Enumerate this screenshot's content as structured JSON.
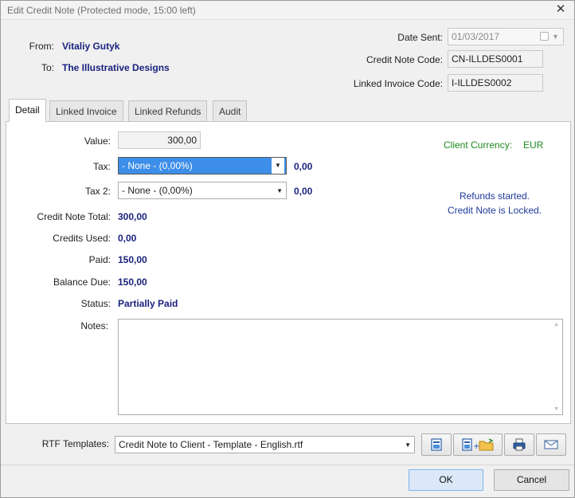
{
  "window": {
    "title": "Edit Credit Note (Protected mode, 15:00 left)"
  },
  "header": {
    "from_label": "From:",
    "from_value": "Vitaliy Gutyk",
    "to_label": "To:",
    "to_value": "The Illustrative Designs",
    "date_sent_label": "Date Sent:",
    "date_sent_value": "01/03/2017",
    "credit_note_code_label": "Credit Note Code:",
    "credit_note_code_value": "CN-ILLDES0001",
    "linked_invoice_code_label": "Linked Invoice Code:",
    "linked_invoice_code_value": "I-ILLDES0002"
  },
  "tabs": [
    {
      "label": "Detail",
      "active": true
    },
    {
      "label": "Linked Invoice",
      "active": false
    },
    {
      "label": "Linked Refunds",
      "active": false
    },
    {
      "label": "Audit",
      "active": false
    }
  ],
  "detail": {
    "value_label": "Value:",
    "value": "300,00",
    "tax_label": "Tax:",
    "tax_selected": "- None - (0,00%)",
    "tax_amount": "0,00",
    "tax2_label": "Tax 2:",
    "tax2_selected": "- None - (0,00%)",
    "tax2_amount": "0,00",
    "credit_note_total_label": "Credit Note Total:",
    "credit_note_total": "300,00",
    "credits_used_label": "Credits Used:",
    "credits_used": "0,00",
    "paid_label": "Paid:",
    "paid": "150,00",
    "balance_due_label": "Balance Due:",
    "balance_due": "150,00",
    "status_label": "Status:",
    "status": "Partially Paid",
    "notes_label": "Notes:",
    "notes_value": "",
    "client_currency_label": "Client Currency:",
    "client_currency": "EUR",
    "lock_message_line1": "Refunds started.",
    "lock_message_line2": "Credit Note is Locked."
  },
  "footer": {
    "rtf_templates_label": "RTF Templates:",
    "rtf_template_selected": "Credit Note to Client - Template - English.rtf",
    "ok_label": "OK",
    "cancel_label": "Cancel"
  },
  "icons": {
    "close": "close-icon",
    "preview": "document-preview-icon",
    "open_folder": "open-folder-icon",
    "print": "printer-icon",
    "email": "envelope-icon"
  }
}
